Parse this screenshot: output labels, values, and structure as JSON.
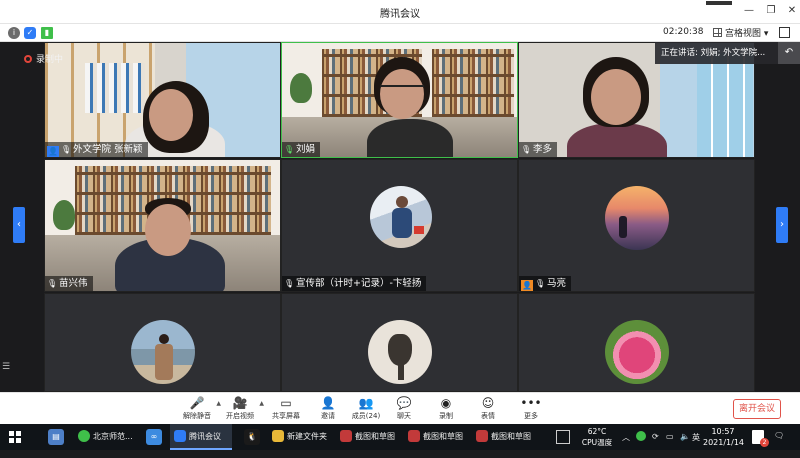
{
  "window": {
    "title": "腾讯会议"
  },
  "statusbar": {
    "timer": "02:20:38",
    "view_label": "宫格视图"
  },
  "recording": {
    "label": "录制中"
  },
  "speaking": {
    "text": "正在讲话: 刘娟; 外文学院..."
  },
  "participants": [
    {
      "name": "外文学院 张新颖",
      "role": "host"
    },
    {
      "name": "刘娟",
      "role": "speaker"
    },
    {
      "name": "李多",
      "role": "member"
    },
    {
      "name": "苗兴伟",
      "role": "member"
    },
    {
      "name": "宣传部（计时+记录）-卞轻扬",
      "role": "member"
    },
    {
      "name": "马亮",
      "role": "guest"
    },
    {
      "name": "",
      "role": "member"
    },
    {
      "name": "",
      "role": "member"
    },
    {
      "name": "",
      "role": "member"
    }
  ],
  "controls": {
    "mute": "解除静音",
    "video": "开启视频",
    "share": "共享屏幕",
    "invite": "邀请",
    "members": "成员(24)",
    "chat": "聊天",
    "record": "录制",
    "emoji": "表情",
    "more": "更多",
    "leave": "离开会议"
  },
  "taskbar": {
    "apps": [
      "北京师范...",
      "腾讯会议",
      "新建文件夹",
      "截图和草图",
      "截图和草图",
      "截图和草图"
    ],
    "temperature": "62°C",
    "temperature_label": "CPU温度",
    "time": "10:57",
    "date": "2021/1/14",
    "notification_count": "2"
  }
}
